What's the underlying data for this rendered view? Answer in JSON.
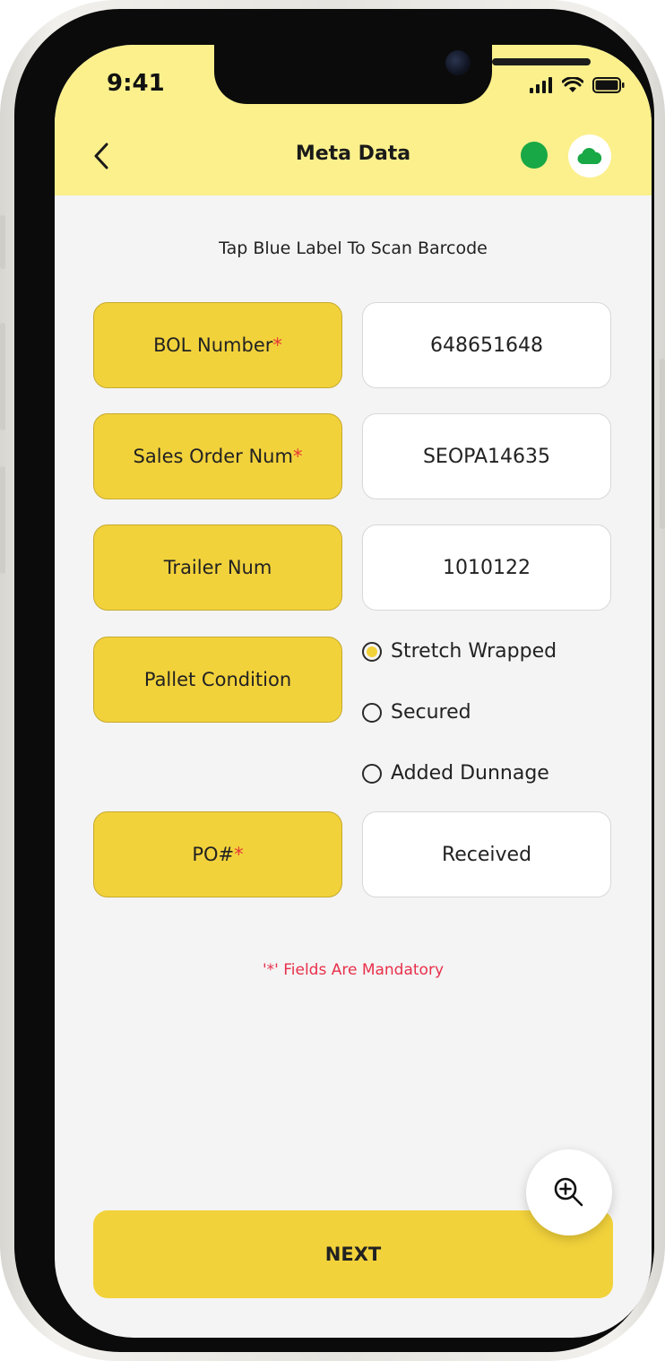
{
  "status_bar": {
    "time": "9:41"
  },
  "header": {
    "title": "Meta Data"
  },
  "instruction": "Tap Blue Label To Scan Barcode",
  "required_marker": "*",
  "fields": [
    {
      "label": "BOL Number",
      "value": "648651648",
      "required": true
    },
    {
      "label": "Sales Order Num",
      "value": "SEOPA14635",
      "required": true
    },
    {
      "label": "Trailer Num",
      "value": "1010122",
      "required": false
    },
    {
      "label": "PO#",
      "value": "Received",
      "required": true
    }
  ],
  "pallet_condition": {
    "label": "Pallet Condition",
    "options": [
      "Stretch Wrapped",
      "Secured",
      "Added Dunnage"
    ],
    "selected": "Stretch Wrapped"
  },
  "mandatory_note": "'*' Fields Are Mandatory",
  "next_button": "NEXT",
  "colors": {
    "header_bg": "#fbf08c",
    "accent": "#f2d23b",
    "required": "#e53935",
    "online": "#18a845",
    "cloud": "#18a845"
  }
}
